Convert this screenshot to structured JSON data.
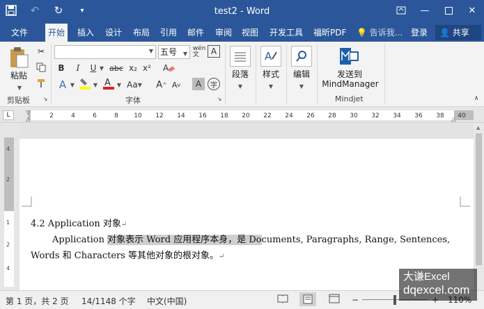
{
  "window": {
    "title": "test2 - Word"
  },
  "tabs": [
    {
      "label": "文件"
    },
    {
      "label": "开始"
    },
    {
      "label": "插入"
    },
    {
      "label": "设计"
    },
    {
      "label": "布局"
    },
    {
      "label": "引用"
    },
    {
      "label": "邮件"
    },
    {
      "label": "审阅"
    },
    {
      "label": "视图"
    },
    {
      "label": "开发工具"
    },
    {
      "label": "福昕PDF"
    }
  ],
  "active_tab": "开始",
  "tellme": "告诉我...",
  "login": "登录",
  "share": "共享",
  "ribbon": {
    "clipboard": {
      "paste_label": "粘贴",
      "group_label": "剪贴板"
    },
    "font": {
      "font_name": "",
      "font_size": "五号",
      "bold": "B",
      "italic": "I",
      "underline": "U",
      "strike": "abc",
      "sub": "x₂",
      "sup": "x²",
      "group_label": "字体"
    },
    "paragraph": {
      "label": "段落"
    },
    "styles": {
      "label": "样式"
    },
    "editing": {
      "label": "编辑"
    },
    "mindjet": {
      "line1": "发送到",
      "line2": "MindManager",
      "group_label": "Mindjet"
    }
  },
  "ruler_numbers": [
    "2",
    "4",
    "6",
    "8",
    "10",
    "12",
    "14",
    "16",
    "18",
    "20",
    "22",
    "24",
    "26",
    "28",
    "30",
    "32",
    "34",
    "36",
    "38",
    "40"
  ],
  "vruler_numbers": [
    "4",
    "2",
    "1",
    "2",
    "4"
  ],
  "document": {
    "heading": "4.2 Application  对象",
    "para_line1_start": "Application ",
    "para_line1_highlight": "对象表示 Word 应用程序本身，是 Do",
    "para_line1_end": "cuments, Paragraphs, Range, Sentences,",
    "para_line2": "Words 和 Characters 等其他对象的根对象。"
  },
  "status": {
    "page": "第 1 页，共 2 页",
    "words": "14/1148 个字",
    "language": "中文(中国)",
    "zoom": "110%"
  },
  "watermark": {
    "line1": "大谦Excel",
    "line2": "dqexcel.com"
  },
  "colors": {
    "titlebar": "#2b579a",
    "ribbon": "#f3f3f3",
    "highlight": "#cfcfcf"
  }
}
